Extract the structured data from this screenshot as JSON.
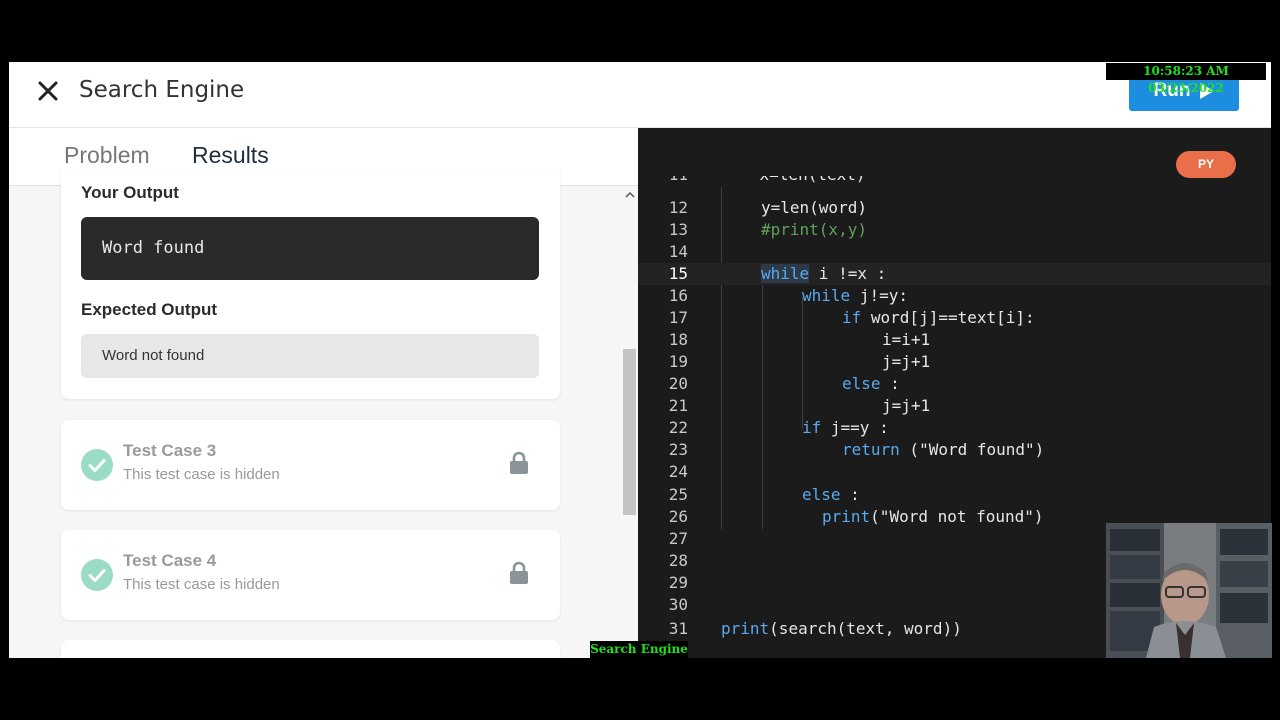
{
  "overlay": {
    "timestamp": "10:58:23 AM 03/23/2022",
    "caption": "Search Engine"
  },
  "header": {
    "title": "Search Engine",
    "run_label": "Run"
  },
  "tabs": [
    {
      "label": "Problem",
      "active": false
    },
    {
      "label": "Results",
      "active": true
    }
  ],
  "results": {
    "your_output_label": "Your Output",
    "your_output_value": "Word found",
    "expected_output_label": "Expected Output",
    "expected_output_value": "Word not found",
    "test_cases": [
      {
        "title": "Test Case 3",
        "subtitle": "This test case is hidden",
        "status": "passed",
        "locked": true
      },
      {
        "title": "Test Case 4",
        "subtitle": "This test case is hidden",
        "status": "passed",
        "locked": true
      }
    ]
  },
  "editor": {
    "language_badge": "PY",
    "active_line": 15,
    "lines": [
      {
        "n": "12",
        "text": "y=len(word)"
      },
      {
        "n": "13",
        "text": "#print(x,y)"
      },
      {
        "n": "14",
        "text": ""
      },
      {
        "n": "15",
        "text": "while i !=x :"
      },
      {
        "n": "16",
        "text": "while j!=y:"
      },
      {
        "n": "17",
        "text": "if word[j]==text[i]:"
      },
      {
        "n": "18",
        "text": "i=i+1"
      },
      {
        "n": "19",
        "text": "j=j+1"
      },
      {
        "n": "20",
        "text": "else :"
      },
      {
        "n": "21",
        "text": "j=j+1"
      },
      {
        "n": "22",
        "text": "if j==y :"
      },
      {
        "n": "23",
        "text": "return (\"Word found\")"
      },
      {
        "n": "24",
        "text": ""
      },
      {
        "n": "25",
        "text": "else :"
      },
      {
        "n": "26",
        "text": "print(\"Word not found\")"
      },
      {
        "n": "27",
        "text": ""
      },
      {
        "n": "28",
        "text": ""
      },
      {
        "n": "29",
        "text": ""
      },
      {
        "n": "30",
        "text": ""
      },
      {
        "n": "31",
        "text": "print(search(text, word))"
      }
    ]
  },
  "colors": {
    "accent": "#1d8de0",
    "badge": "#e86f4a",
    "keyword": "#5aa9ee",
    "comment": "#5fa05f",
    "passed": "#9bdcc4"
  }
}
